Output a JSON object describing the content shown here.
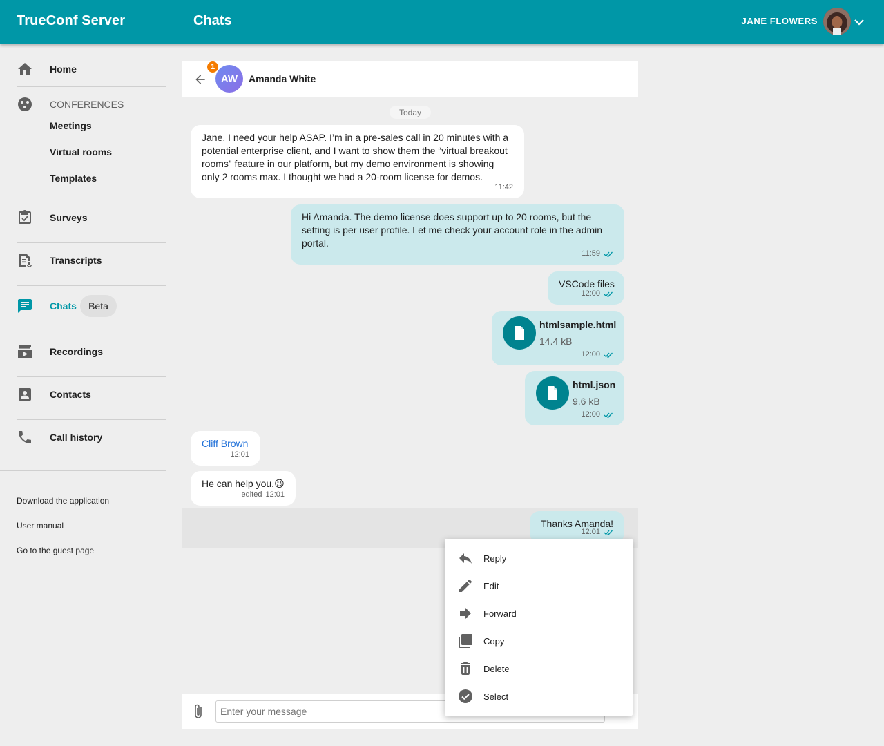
{
  "header": {
    "app_title": "TrueConf Server",
    "page_title": "Chats",
    "user_name": "JANE FLOWERS",
    "accent_color": "#0097a7"
  },
  "sidebar": {
    "home": "Home",
    "conferences_section": "CONFERENCES",
    "meetings": "Meetings",
    "virtual_rooms": "Virtual rooms",
    "templates": "Templates",
    "surveys": "Surveys",
    "transcripts": "Transcripts",
    "chats": "Chats",
    "chats_badge": "Beta",
    "recordings": "Recordings",
    "contacts": "Contacts",
    "call_history": "Call history",
    "footer_links": [
      "Download the application",
      "User manual",
      "Go to the guest page"
    ]
  },
  "chat": {
    "contact_name": "Amanda White",
    "contact_initials": "AW",
    "unread_count": "1",
    "date_divider": "Today",
    "messages": [
      {
        "direction": "in",
        "text": "Jane, I need your help ASAP. I’m in a pre-sales call in 20 minutes with a\npotential enterprise client, and I want to show them the “virtual breakout\nrooms” feature in our platform, but my demo environment is showing\nonly 2 rooms max. I thought we had a 20-room license for demos.",
        "time": "11:42"
      },
      {
        "direction": "out",
        "text": "Hi Amanda. The demo license does support up to 20 rooms, but the\nsetting is per user profile. Let me check your account role in the admin\nportal.",
        "time": "11:59"
      },
      {
        "direction": "out",
        "text": "VSCode files",
        "time": "12:00"
      },
      {
        "direction": "out",
        "type": "file",
        "file_name": "htmlsample.html",
        "file_size": "14.4 kB",
        "time": "12:00"
      },
      {
        "direction": "out",
        "type": "file",
        "file_name": "html.json",
        "file_size": "9.6 kB",
        "time": "12:00"
      },
      {
        "direction": "in",
        "type": "link",
        "text": "Cliff Brown",
        "time": "12:01"
      },
      {
        "direction": "in",
        "text": "He can help you.😉",
        "edited_label": "edited",
        "time": "12:01"
      },
      {
        "direction": "out",
        "text": "Thanks Amanda!",
        "time": "12:01"
      }
    ],
    "composer_placeholder": "Enter your message"
  },
  "context_menu": {
    "items": [
      {
        "label": "Reply",
        "icon": "reply-icon"
      },
      {
        "label": "Edit",
        "icon": "pencil-icon"
      },
      {
        "label": "Forward",
        "icon": "forward-icon"
      },
      {
        "label": "Copy",
        "icon": "copy-icon"
      },
      {
        "label": "Delete",
        "icon": "trash-icon"
      },
      {
        "label": "Select",
        "icon": "check-circle-icon"
      }
    ]
  }
}
